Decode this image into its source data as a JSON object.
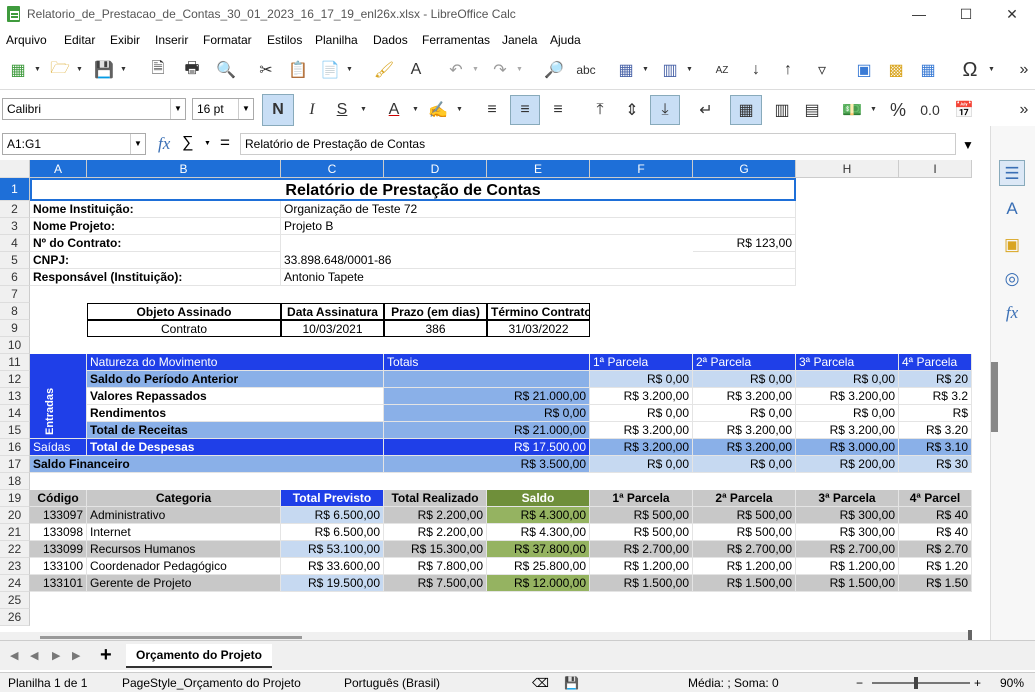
{
  "window": {
    "title": "Relatorio_de_Prestacao_de_Contas_30_01_2023_16_17_19_enl26x.xlsx - LibreOffice Calc"
  },
  "menu": [
    "Arquivo",
    "Editar",
    "Exibir",
    "Inserir",
    "Formatar",
    "Estilos",
    "Planilha",
    "Dados",
    "Ferramentas",
    "Janela",
    "Ajuda"
  ],
  "format": {
    "font": "Calibri",
    "size": "16 pt"
  },
  "formula": {
    "cellref": "A1:G1",
    "content": "Relatório de Prestação de Contas"
  },
  "columns": [
    "A",
    "B",
    "C",
    "D",
    "E",
    "F",
    "G",
    "H",
    "I"
  ],
  "rows": [
    "1",
    "2",
    "3",
    "4",
    "5",
    "6",
    "7",
    "8",
    "9",
    "10",
    "11",
    "12",
    "13",
    "14",
    "15",
    "16",
    "17",
    "18",
    "19",
    "20",
    "21",
    "22",
    "23",
    "24",
    "25",
    "26"
  ],
  "report": {
    "title": "Relatório de Prestação de Contas",
    "inst_label": "Nome Instituição:",
    "inst": "Organização de Teste 72",
    "proj_label": "Nome Projeto:",
    "proj": "Projeto B",
    "contract_label": "Nº do Contrato:",
    "contract_value": "R$ 123,00",
    "cnpj_label": "CNPJ:",
    "cnpj": "33.898.648/0001-86",
    "resp_label": "Responsável (Instituição):",
    "resp": "Antonio Tapete",
    "obj_h": "Objeto Assinado",
    "date_h": "Data Assinatura",
    "term_h": "Prazo (em dias)",
    "end_h": "Término Contrato",
    "obj": "Contrato",
    "date": "10/03/2021",
    "term": "386",
    "end": "31/03/2022"
  },
  "movement": {
    "hdr": "Natureza do Movimento",
    "totais": "Totais",
    "parcelas": [
      "1ª Parcela",
      "2ª Parcela",
      "3ª Parcela",
      "4ª Parcela"
    ],
    "entradas": "Entradas",
    "saidas": "Saídas",
    "rows": [
      {
        "label": "Saldo do Período Anterior",
        "total": "",
        "p": [
          "R$ 0,00",
          "R$ 0,00",
          "R$ 0,00",
          "R$ 20"
        ]
      },
      {
        "label": "Valores Repassados",
        "total": "R$ 21.000,00",
        "p": [
          "R$ 3.200,00",
          "R$ 3.200,00",
          "R$ 3.200,00",
          "R$ 3.2"
        ]
      },
      {
        "label": "Rendimentos",
        "total": "R$ 0,00",
        "p": [
          "R$ 0,00",
          "R$ 0,00",
          "R$ 0,00",
          "R$"
        ]
      },
      {
        "label": "Total de Receitas",
        "total": "R$ 21.000,00",
        "p": [
          "R$ 3.200,00",
          "R$ 3.200,00",
          "R$ 3.200,00",
          "R$ 3.20"
        ]
      },
      {
        "label": "Total de Despesas",
        "total": "R$ 17.500,00",
        "p": [
          "R$ 3.200,00",
          "R$ 3.200,00",
          "R$ 3.000,00",
          "R$ 3.10"
        ]
      },
      {
        "label": "Saldo Financeiro",
        "total": "R$ 3.500,00",
        "p": [
          "R$ 0,00",
          "R$ 0,00",
          "R$ 200,00",
          "R$ 30"
        ]
      }
    ]
  },
  "budget": {
    "headers": [
      "Código",
      "Categoria",
      "Total Previsto",
      "Total Realizado",
      "Saldo",
      "1ª Parcela",
      "2ª Parcela",
      "3ª Parcela",
      "4ª Parcel"
    ],
    "rows": [
      [
        "133097",
        "Administrativo",
        "R$ 6.500,00",
        "R$ 2.200,00",
        "R$ 4.300,00",
        "R$ 500,00",
        "R$ 500,00",
        "R$ 300,00",
        "R$ 40"
      ],
      [
        "133098",
        "Internet",
        "R$ 6.500,00",
        "R$ 2.200,00",
        "R$ 4.300,00",
        "R$ 500,00",
        "R$ 500,00",
        "R$ 300,00",
        "R$ 40"
      ],
      [
        "133099",
        "Recursos Humanos",
        "R$ 53.100,00",
        "R$ 15.300,00",
        "R$ 37.800,00",
        "R$ 2.700,00",
        "R$ 2.700,00",
        "R$ 2.700,00",
        "R$ 2.70"
      ],
      [
        "133100",
        "Coordenador Pedagógico",
        "R$ 33.600,00",
        "R$ 7.800,00",
        "R$ 25.800,00",
        "R$ 1.200,00",
        "R$ 1.200,00",
        "R$ 1.200,00",
        "R$ 1.20"
      ],
      [
        "133101",
        "Gerente de Projeto",
        "R$ 19.500,00",
        "R$ 7.500,00",
        "R$ 12.000,00",
        "R$ 1.500,00",
        "R$ 1.500,00",
        "R$ 1.500,00",
        "R$ 1.50"
      ]
    ]
  },
  "sheet_tab": "Orçamento do Projeto",
  "status": {
    "sheet": "Planilha 1 de 1",
    "style": "PageStyle_Orçamento do Projeto",
    "lang": "Português (Brasil)",
    "calc": "Média: ; Soma: 0",
    "zoom": "90%"
  }
}
